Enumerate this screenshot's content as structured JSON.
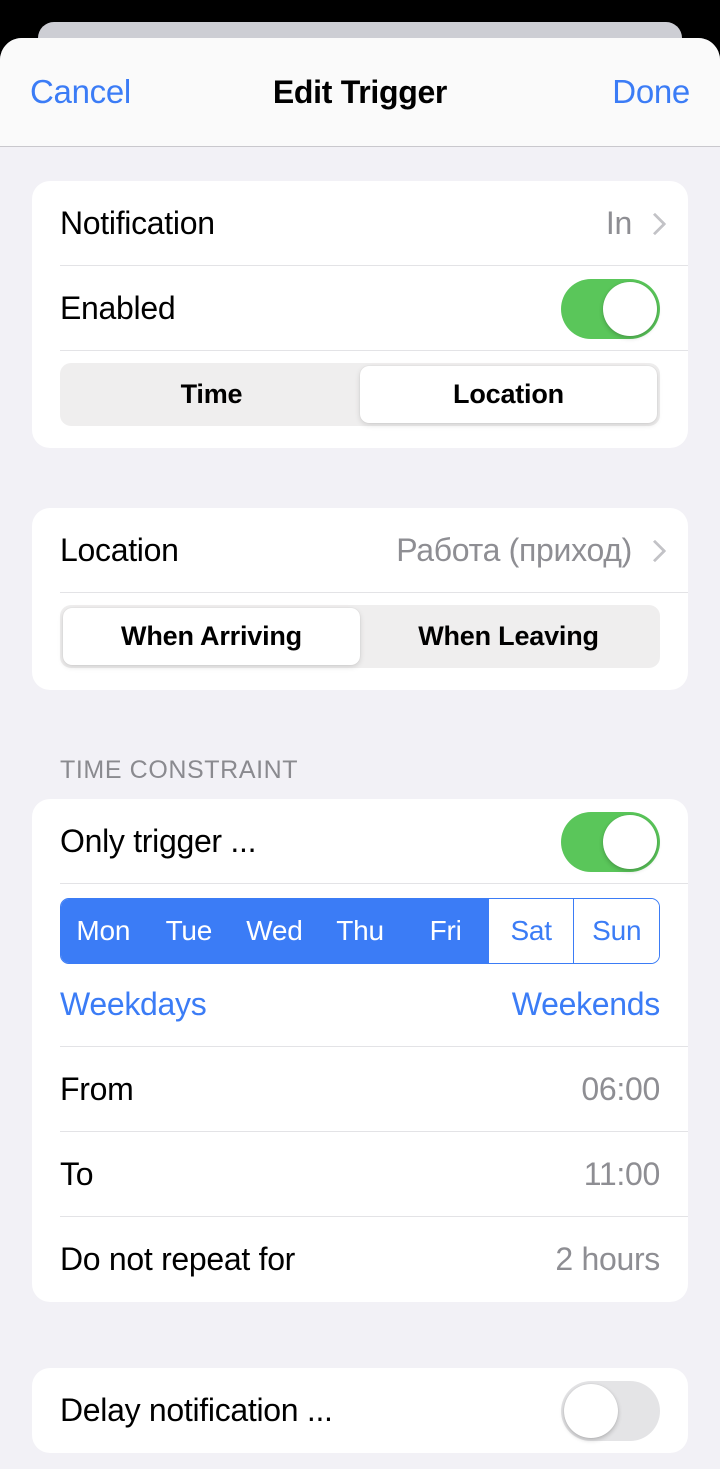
{
  "navbar": {
    "cancel_label": "Cancel",
    "title": "Edit Trigger",
    "done_label": "Done"
  },
  "colors": {
    "accent_blue": "#3b7cf6",
    "toggle_on_green": "#5ac65a",
    "toggle_off_grey": "#e4e4e6",
    "page_background": "#f2f1f6",
    "card_background": "#ffffff",
    "secondary_text": "#8e8e93"
  },
  "trigger_section": {
    "notification": {
      "label": "Notification",
      "value": "In",
      "chevron": "chevron-right-icon"
    },
    "enabled": {
      "label": "Enabled",
      "state": "on"
    },
    "type_segmented": {
      "options": [
        "Time",
        "Location"
      ],
      "selected": "Location"
    }
  },
  "location_section": {
    "location": {
      "label": "Location",
      "value": "Работа (приход)",
      "chevron": "chevron-right-icon"
    },
    "direction_segmented": {
      "options": [
        "When Arriving",
        "When Leaving"
      ],
      "selected": "When Arriving"
    }
  },
  "time_constraint_section": {
    "header": "TIME CONSTRAINT",
    "only_trigger": {
      "label": "Only trigger ...",
      "state": "on"
    },
    "weekdays": {
      "days": [
        {
          "label": "Mon",
          "selected": true
        },
        {
          "label": "Tue",
          "selected": true
        },
        {
          "label": "Wed",
          "selected": true
        },
        {
          "label": "Thu",
          "selected": true
        },
        {
          "label": "Fri",
          "selected": true
        },
        {
          "label": "Sat",
          "selected": false
        },
        {
          "label": "Sun",
          "selected": false
        }
      ]
    },
    "quick_links": {
      "weekdays_label": "Weekdays",
      "weekends_label": "Weekends"
    },
    "from": {
      "label": "From",
      "value": "06:00"
    },
    "to": {
      "label": "To",
      "value": "11:00"
    },
    "no_repeat": {
      "label": "Do not repeat for",
      "value": "2 hours"
    }
  },
  "delay_section": {
    "delay_notification": {
      "label": "Delay notification ...",
      "state": "off"
    }
  }
}
